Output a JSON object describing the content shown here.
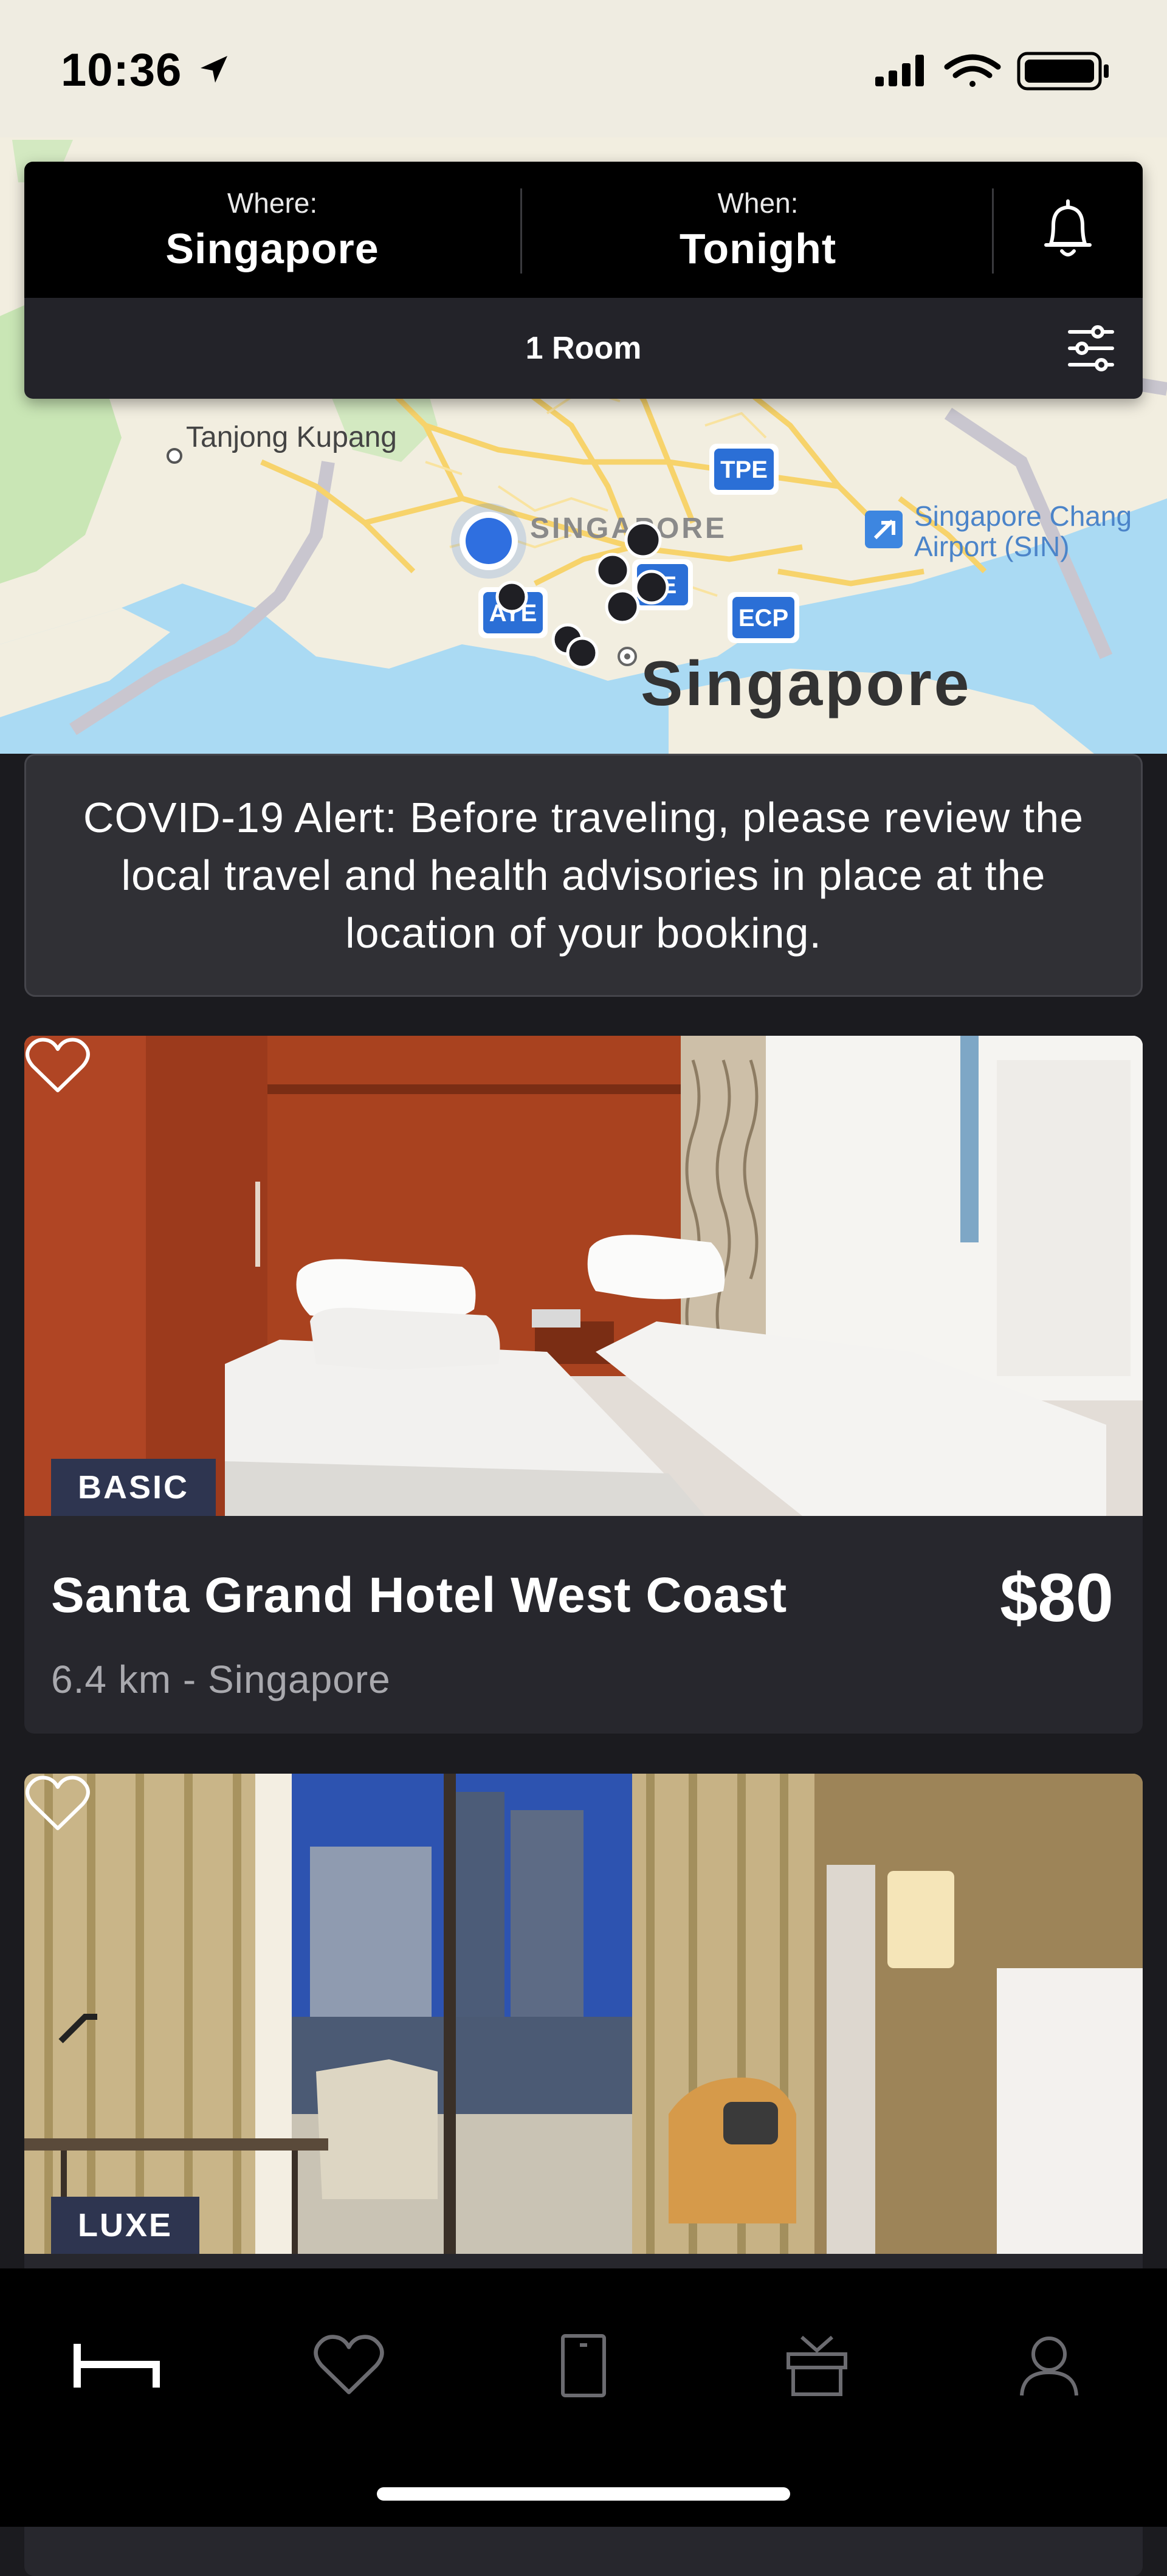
{
  "status_bar": {
    "time": "10:36"
  },
  "search": {
    "where_label": "Where:",
    "where_value": "Singapore",
    "when_label": "When:",
    "when_value": "Tonight",
    "rooms": "1 Room"
  },
  "map": {
    "labels": {
      "tanjong_kupang": "Tanjong Kupang",
      "tpe": "TPE",
      "aye": "AYE",
      "ecp": "ECP",
      "cte": "E",
      "singapore_small": "SINGAPORE",
      "airport_line1": "Singapore Chang",
      "airport_line2": "Airport (SIN)",
      "singapore_big": "Singapore"
    }
  },
  "alert": {
    "text": "COVID-19 Alert: Before traveling, please review the local travel and health advisories in place at the location of your booking."
  },
  "hotels": [
    {
      "tier": "BASIC",
      "name": "Santa Grand Hotel West Coast",
      "price": "$80",
      "location": "6.4 km - Singapore"
    },
    {
      "tier": "LUXE"
    }
  ],
  "tabs": [
    "bed-icon",
    "heart-icon",
    "door-icon",
    "gift-icon",
    "profile-icon"
  ],
  "colors": {
    "accent_blue": "#2f6fe0",
    "tier_badge": "#2e3550",
    "panel": "#232329"
  }
}
